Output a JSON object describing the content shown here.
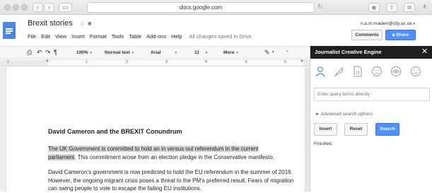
{
  "browser": {
    "url": "docs.google.com",
    "back_glyph": "‹",
    "forward_glyph": "›",
    "sidebar_glyph": "▭",
    "reload_glyph": "↻",
    "download_glyph": "◉",
    "share_glyph": "⇪",
    "tabs_glyph": "⧉",
    "newtab_glyph": "+"
  },
  "doc": {
    "title": "Brexit stories",
    "star_glyph": "☆",
    "folder_glyph": "■",
    "menu": [
      "File",
      "Edit",
      "View",
      "Insert",
      "Format",
      "Tools",
      "Table",
      "Add-ons",
      "Help"
    ],
    "saved_status": "All changes saved in Drive",
    "user_email": "n.a.m.maiden@city.ac.uk",
    "comments_label": "Comments",
    "share_label": "Share"
  },
  "toolbar": {
    "print_glyph": "⎙",
    "undo_glyph": "↶",
    "redo_glyph": "↷",
    "paint_glyph": "¶",
    "zoom": "100%",
    "style": "Normal text",
    "font": "Arial",
    "size": "11",
    "more": "More",
    "pen_glyph": "✎",
    "collapse_glyph": "⌃"
  },
  "ruler": {
    "numbers": [
      "1",
      "1",
      "2",
      "3",
      "4",
      "5",
      "6"
    ]
  },
  "document": {
    "heading": "David Cameron and the BREXIT Conundrum",
    "para1_highlight_a": "The UK Government is committed to hold an in versus out referendum in the current",
    "para1_highlight_b": "parliament",
    "para1_rest": ". This commitment arose from an election pledge in the Conservative manifesto.",
    "para2": "David Cameron’s government is now predicted to hold the EU referendum in the summer of 2016. However, the ongoing migrant crisis poses a threat to the PM’s preferred result. Fears of migration can swing people to vote to escape the failing EU institutions."
  },
  "sidebar": {
    "title": "Journalist Creative Engine",
    "close_glyph": "✕",
    "icons": [
      "person-icon",
      "feather-icon",
      "document-icon",
      "sad-face-icon",
      "eye-icon",
      "happy-face-icon"
    ],
    "query_placeholder": "Enter query terms directly",
    "advanced_label": "► Advanced search options",
    "insert_label": "Insert",
    "reset_label": "Reset",
    "search_label": "Search",
    "status": "Finished.",
    "accent_color": "#4d90fe"
  }
}
